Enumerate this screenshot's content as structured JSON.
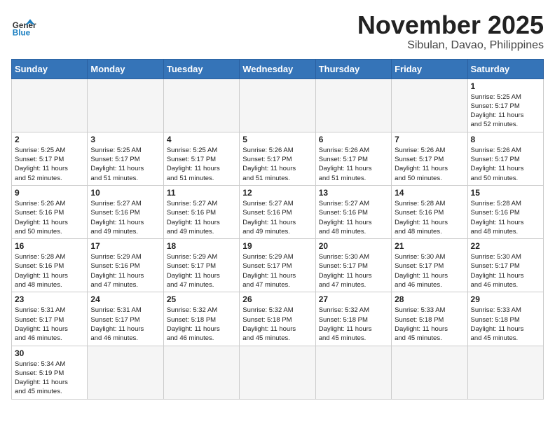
{
  "header": {
    "logo_general": "General",
    "logo_blue": "Blue",
    "month_title": "November 2025",
    "location": "Sibulan, Davao, Philippines"
  },
  "weekdays": [
    "Sunday",
    "Monday",
    "Tuesday",
    "Wednesday",
    "Thursday",
    "Friday",
    "Saturday"
  ],
  "weeks": [
    [
      {
        "day": "",
        "info": ""
      },
      {
        "day": "",
        "info": ""
      },
      {
        "day": "",
        "info": ""
      },
      {
        "day": "",
        "info": ""
      },
      {
        "day": "",
        "info": ""
      },
      {
        "day": "",
        "info": ""
      },
      {
        "day": "1",
        "info": "Sunrise: 5:25 AM\nSunset: 5:17 PM\nDaylight: 11 hours\nand 52 minutes."
      }
    ],
    [
      {
        "day": "2",
        "info": "Sunrise: 5:25 AM\nSunset: 5:17 PM\nDaylight: 11 hours\nand 52 minutes."
      },
      {
        "day": "3",
        "info": "Sunrise: 5:25 AM\nSunset: 5:17 PM\nDaylight: 11 hours\nand 51 minutes."
      },
      {
        "day": "4",
        "info": "Sunrise: 5:25 AM\nSunset: 5:17 PM\nDaylight: 11 hours\nand 51 minutes."
      },
      {
        "day": "5",
        "info": "Sunrise: 5:26 AM\nSunset: 5:17 PM\nDaylight: 11 hours\nand 51 minutes."
      },
      {
        "day": "6",
        "info": "Sunrise: 5:26 AM\nSunset: 5:17 PM\nDaylight: 11 hours\nand 51 minutes."
      },
      {
        "day": "7",
        "info": "Sunrise: 5:26 AM\nSunset: 5:17 PM\nDaylight: 11 hours\nand 50 minutes."
      },
      {
        "day": "8",
        "info": "Sunrise: 5:26 AM\nSunset: 5:17 PM\nDaylight: 11 hours\nand 50 minutes."
      }
    ],
    [
      {
        "day": "9",
        "info": "Sunrise: 5:26 AM\nSunset: 5:16 PM\nDaylight: 11 hours\nand 50 minutes."
      },
      {
        "day": "10",
        "info": "Sunrise: 5:27 AM\nSunset: 5:16 PM\nDaylight: 11 hours\nand 49 minutes."
      },
      {
        "day": "11",
        "info": "Sunrise: 5:27 AM\nSunset: 5:16 PM\nDaylight: 11 hours\nand 49 minutes."
      },
      {
        "day": "12",
        "info": "Sunrise: 5:27 AM\nSunset: 5:16 PM\nDaylight: 11 hours\nand 49 minutes."
      },
      {
        "day": "13",
        "info": "Sunrise: 5:27 AM\nSunset: 5:16 PM\nDaylight: 11 hours\nand 48 minutes."
      },
      {
        "day": "14",
        "info": "Sunrise: 5:28 AM\nSunset: 5:16 PM\nDaylight: 11 hours\nand 48 minutes."
      },
      {
        "day": "15",
        "info": "Sunrise: 5:28 AM\nSunset: 5:16 PM\nDaylight: 11 hours\nand 48 minutes."
      }
    ],
    [
      {
        "day": "16",
        "info": "Sunrise: 5:28 AM\nSunset: 5:16 PM\nDaylight: 11 hours\nand 48 minutes."
      },
      {
        "day": "17",
        "info": "Sunrise: 5:29 AM\nSunset: 5:16 PM\nDaylight: 11 hours\nand 47 minutes."
      },
      {
        "day": "18",
        "info": "Sunrise: 5:29 AM\nSunset: 5:17 PM\nDaylight: 11 hours\nand 47 minutes."
      },
      {
        "day": "19",
        "info": "Sunrise: 5:29 AM\nSunset: 5:17 PM\nDaylight: 11 hours\nand 47 minutes."
      },
      {
        "day": "20",
        "info": "Sunrise: 5:30 AM\nSunset: 5:17 PM\nDaylight: 11 hours\nand 47 minutes."
      },
      {
        "day": "21",
        "info": "Sunrise: 5:30 AM\nSunset: 5:17 PM\nDaylight: 11 hours\nand 46 minutes."
      },
      {
        "day": "22",
        "info": "Sunrise: 5:30 AM\nSunset: 5:17 PM\nDaylight: 11 hours\nand 46 minutes."
      }
    ],
    [
      {
        "day": "23",
        "info": "Sunrise: 5:31 AM\nSunset: 5:17 PM\nDaylight: 11 hours\nand 46 minutes."
      },
      {
        "day": "24",
        "info": "Sunrise: 5:31 AM\nSunset: 5:17 PM\nDaylight: 11 hours\nand 46 minutes."
      },
      {
        "day": "25",
        "info": "Sunrise: 5:32 AM\nSunset: 5:18 PM\nDaylight: 11 hours\nand 46 minutes."
      },
      {
        "day": "26",
        "info": "Sunrise: 5:32 AM\nSunset: 5:18 PM\nDaylight: 11 hours\nand 45 minutes."
      },
      {
        "day": "27",
        "info": "Sunrise: 5:32 AM\nSunset: 5:18 PM\nDaylight: 11 hours\nand 45 minutes."
      },
      {
        "day": "28",
        "info": "Sunrise: 5:33 AM\nSunset: 5:18 PM\nDaylight: 11 hours\nand 45 minutes."
      },
      {
        "day": "29",
        "info": "Sunrise: 5:33 AM\nSunset: 5:18 PM\nDaylight: 11 hours\nand 45 minutes."
      }
    ],
    [
      {
        "day": "30",
        "info": "Sunrise: 5:34 AM\nSunset: 5:19 PM\nDaylight: 11 hours\nand 45 minutes."
      },
      {
        "day": "",
        "info": ""
      },
      {
        "day": "",
        "info": ""
      },
      {
        "day": "",
        "info": ""
      },
      {
        "day": "",
        "info": ""
      },
      {
        "day": "",
        "info": ""
      },
      {
        "day": "",
        "info": ""
      }
    ]
  ]
}
